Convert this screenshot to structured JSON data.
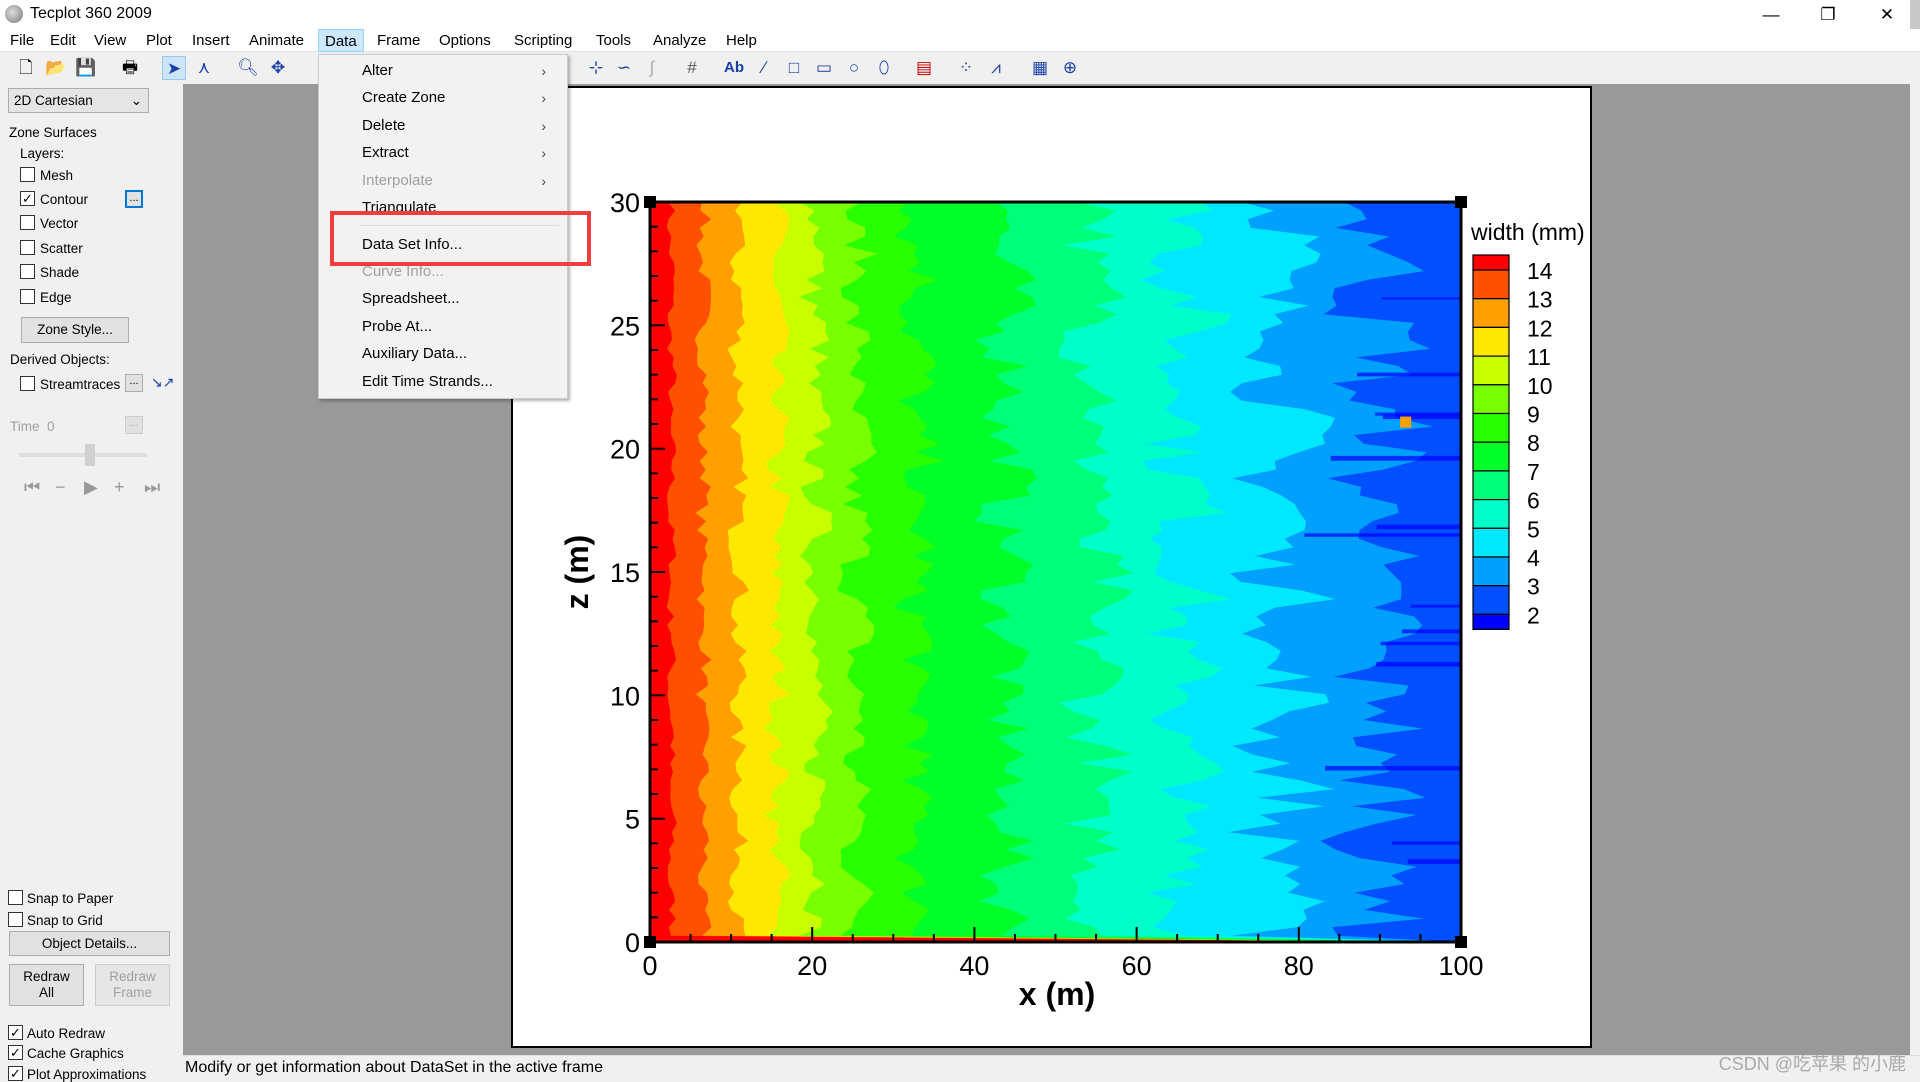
{
  "window": {
    "title": "Tecplot 360 2009",
    "minimize": "—",
    "restore": "❐",
    "close": "✕"
  },
  "menubar": [
    "File",
    "Edit",
    "View",
    "Plot",
    "Insert",
    "Animate",
    "Data",
    "Frame",
    "Options",
    "Scripting",
    "Tools",
    "Analyze",
    "Help"
  ],
  "active_menu": "Data",
  "data_menu": {
    "items": [
      {
        "label": "Alter",
        "submenu": true,
        "enabled": true
      },
      {
        "label": "Create Zone",
        "submenu": true,
        "enabled": true
      },
      {
        "label": "Delete",
        "submenu": true,
        "enabled": true
      },
      {
        "label": "Extract",
        "submenu": true,
        "enabled": true
      },
      {
        "label": "Interpolate",
        "submenu": true,
        "enabled": false
      },
      {
        "label": "Triangulate",
        "submenu": false,
        "enabled": true
      },
      {
        "label": "Data Set Info...",
        "submenu": false,
        "enabled": true,
        "highlighted": true
      },
      {
        "label": "Curve Info...",
        "submenu": false,
        "enabled": false
      },
      {
        "label": "Spreadsheet...",
        "submenu": false,
        "enabled": true
      },
      {
        "label": "Probe At...",
        "submenu": false,
        "enabled": true
      },
      {
        "label": "Auxiliary Data...",
        "submenu": false,
        "enabled": true
      },
      {
        "label": "Edit Time Strands...",
        "submenu": false,
        "enabled": true
      }
    ],
    "arrow": "›"
  },
  "highlight_color": "#f33c3c",
  "sidebar": {
    "plot_type": "2D Cartesian",
    "zone_surfaces": "Zone Surfaces",
    "layers_label": "Layers:",
    "layers": [
      {
        "label": "Mesh",
        "checked": false
      },
      {
        "label": "Contour",
        "checked": true
      },
      {
        "label": "Vector",
        "checked": false
      },
      {
        "label": "Scatter",
        "checked": false
      },
      {
        "label": "Shade",
        "checked": false
      },
      {
        "label": "Edge",
        "checked": false
      }
    ],
    "zone_style": "Zone Style...",
    "derived_objects": "Derived Objects:",
    "streamtraces": "Streamtraces",
    "time_label": "Time",
    "time_value": "0",
    "dots": "...",
    "snap_paper": "Snap to Paper",
    "snap_grid": "Snap to Grid",
    "object_details": "Object Details...",
    "redraw_all": "Redraw All",
    "redraw_frame": "Redraw Frame",
    "auto_redraw": "Auto Redraw",
    "cache_graphics": "Cache Graphics",
    "plot_approx": "Plot Approximations",
    "check": "✓"
  },
  "status": "Modify or get information about DataSet in the active frame",
  "watermark": "CSDN @吃苹果 的小鹿",
  "chart_data": {
    "type": "heatmap",
    "subtype": "filled contour",
    "xlabel": "x (m)",
    "ylabel": "z (m)",
    "xlim": [
      0,
      100
    ],
    "ylim": [
      0,
      30
    ],
    "xticks": [
      "0",
      "20",
      "40",
      "60",
      "80",
      "100"
    ],
    "yticks": [
      "0",
      "5",
      "10",
      "15",
      "20",
      "25",
      "30"
    ],
    "legend_title": "width (mm)",
    "legend_placement": "right",
    "levels": [
      "14",
      "13",
      "12",
      "11",
      "10",
      "9",
      "8",
      "7",
      "6",
      "5",
      "4",
      "3",
      "2"
    ],
    "level_colors": [
      "#ff0000",
      "#ff5000",
      "#ffa000",
      "#ffe800",
      "#c8ff00",
      "#78ff00",
      "#28ff00",
      "#00ff28",
      "#00ff78",
      "#00ffc8",
      "#00e8ff",
      "#00a0ff",
      "#0050ff",
      "#0000ff"
    ],
    "band_boundaries_x": [
      2.6,
      6.6,
      10.9,
      15.7,
      20.5,
      25.5,
      33,
      44,
      55,
      66,
      78,
      90
    ],
    "trend": "width decreases from ~14.5 mm at x=0 to ~2.5 mm at x=100"
  }
}
